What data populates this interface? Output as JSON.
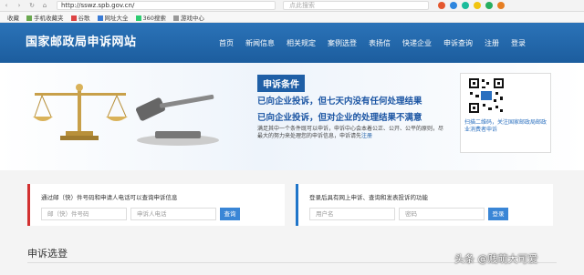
{
  "browser": {
    "back_icon": "back-arrow-icon",
    "forward_icon": "forward-arrow-icon",
    "reload_icon": "reload-icon",
    "home_icon": "home-icon",
    "url": "http://sswz.spb.gov.cn/",
    "search_placeholder": "点此搜索"
  },
  "bookmarks": [
    {
      "label": "收藏"
    },
    {
      "label": "手机收藏夹"
    },
    {
      "label": "谷歌"
    },
    {
      "label": "网址大全"
    },
    {
      "label": "360搜索"
    },
    {
      "label": "游戏中心"
    }
  ],
  "header": {
    "site_title": "国家邮政局申诉网站",
    "nav": [
      "首页",
      "新闻信息",
      "相关规定",
      "案例选登",
      "表扬信",
      "快递企业",
      "申诉查询",
      "注册",
      "登录"
    ]
  },
  "banner": {
    "title": "申诉条件",
    "line1": "已向企业投诉，但七天内没有任何处理结果",
    "line2": "已向企业投诉，但对企业的处理结果不满意",
    "desc": "满足其中一个条件既可以申诉，申诉中心会本着公正、公开、公平的原则，尽最大的努力来处理您的申诉信息，申诉请先",
    "desc_link": "注册",
    "qr_text": "扫描二维码，关注国家邮政局邮政业消费者申诉"
  },
  "query_left": {
    "label": "通过邮（快）件号码和申请人电话可以查询申诉信息",
    "field1_placeholder": "邮（快）件号码",
    "field2_placeholder": "申诉人电话",
    "button": "查询"
  },
  "query_right": {
    "label": "登录后具有网上申诉、查询和发表投诉的功能",
    "field1_placeholder": "用户名",
    "field2_placeholder": "密码",
    "button": "登录"
  },
  "section": {
    "title": "申诉选登"
  },
  "watermark": "头条 @贱萌大可爱",
  "colors": {
    "header_blue": "#2b73b8",
    "accent_red": "#d23030",
    "accent_blue": "#1f75c9"
  }
}
